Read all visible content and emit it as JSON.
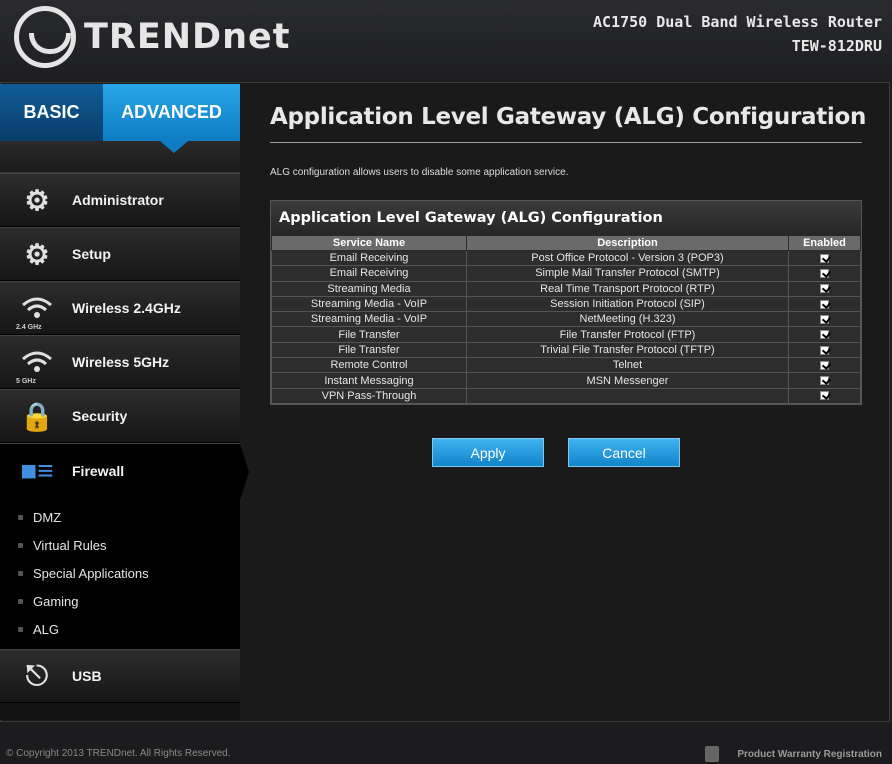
{
  "header": {
    "brand": "TRENDnet",
    "product_line": "AC1750 Dual Band Wireless Router",
    "model": "TEW-812DRU"
  },
  "tabs": [
    {
      "label": "BASIC",
      "active": false
    },
    {
      "label": "ADVANCED",
      "active": true
    }
  ],
  "sidebar": {
    "items": [
      {
        "label": "Administrator",
        "icon": "administrator-icon"
      },
      {
        "label": "Setup",
        "icon": "gears-icon"
      },
      {
        "label": "Wireless 2.4GHz",
        "icon": "wifi-icon",
        "badge": "2.4 GHz"
      },
      {
        "label": "Wireless 5GHz",
        "icon": "wifi-icon",
        "badge": "5 GHz"
      },
      {
        "label": "Security",
        "icon": "lock-key-icon"
      },
      {
        "label": "Firewall",
        "icon": "firewall-icon",
        "active": true
      },
      {
        "label": "USB",
        "icon": "usb-icon"
      }
    ],
    "firewall_subitems": [
      "DMZ",
      "Virtual Rules",
      "Special Applications",
      "Gaming",
      "ALG"
    ]
  },
  "main": {
    "title": "Application Level Gateway (ALG) Configuration",
    "intro": "ALG configuration allows users to disable some application service.",
    "table_title": "Application Level Gateway (ALG) Configuration",
    "columns": [
      "Service Name",
      "Description",
      "Enabled"
    ],
    "rows": [
      {
        "service": "Email Receiving",
        "description": "Post Office Protocol - Version 3 (POP3)",
        "enabled": true
      },
      {
        "service": "Email Receiving",
        "description": "Simple Mail Transfer Protocol (SMTP)",
        "enabled": true
      },
      {
        "service": "Streaming Media",
        "description": "Real Time Transport Protocol (RTP)",
        "enabled": true
      },
      {
        "service": "Streaming Media - VoIP",
        "description": "Session Initiation Protocol (SIP)",
        "enabled": true
      },
      {
        "service": "Streaming Media - VoIP",
        "description": "NetMeeting (H.323)",
        "enabled": true
      },
      {
        "service": "File Transfer",
        "description": "File Transfer Protocol (FTP)",
        "enabled": true
      },
      {
        "service": "File Transfer",
        "description": "Trivial File Transfer Protocol (TFTP)",
        "enabled": true
      },
      {
        "service": "Remote Control",
        "description": "Telnet",
        "enabled": true
      },
      {
        "service": "Instant Messaging",
        "description": "MSN Messenger",
        "enabled": true
      },
      {
        "service": "VPN Pass-Through",
        "description": "",
        "enabled": true
      }
    ],
    "apply_label": "Apply",
    "cancel_label": "Cancel"
  },
  "footer": {
    "copyright": "© Copyright 2013 TRENDnet. All Rights Reserved.",
    "warranty": "Product Warranty Registration"
  },
  "colors": {
    "accent": "#1a8fd8",
    "basic_tab": "#0f5d97",
    "background": "#1c1c1e"
  }
}
